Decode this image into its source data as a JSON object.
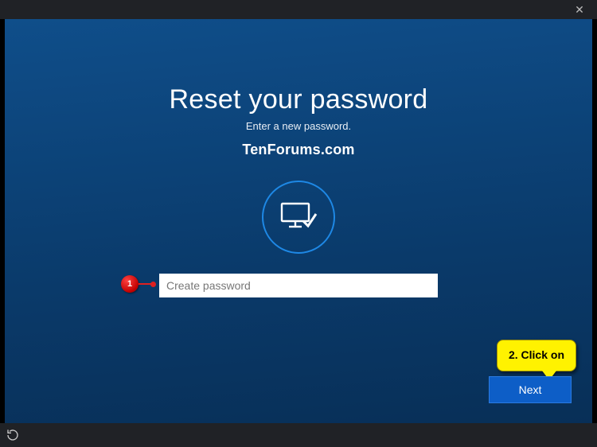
{
  "titlebar": {
    "close_glyph": "✕"
  },
  "page": {
    "heading": "Reset your password",
    "subheading": "Enter a new password.",
    "watermark": "TenForums.com"
  },
  "form": {
    "password_placeholder": "Create password",
    "password_value": ""
  },
  "actions": {
    "next_label": "Next"
  },
  "annotations": {
    "step1_number": "1",
    "step2_text": "2. Click on"
  },
  "bottombar": {
    "power_glyph": "⟳"
  }
}
